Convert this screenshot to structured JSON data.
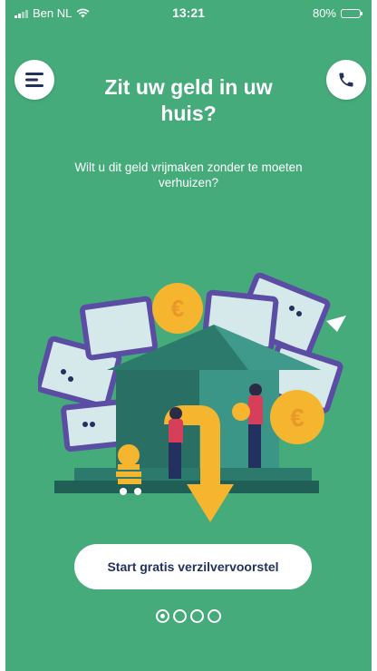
{
  "status_bar": {
    "carrier": "Ben NL",
    "time": "13:21",
    "battery": "80%",
    "battery_level": 0.8
  },
  "header": {
    "menu_icon": "menu-icon",
    "phone_icon": "phone-icon",
    "title": "Zit uw geld in uw huis?",
    "subtitle": "Wilt u dit geld vrijmaken zonder te moeten verhuizen?"
  },
  "illustration": {
    "description_icon": "house-money-illustration"
  },
  "cta": {
    "label": "Start gratis verzilvervoorstel"
  },
  "pagination": {
    "total": 4,
    "active": 1
  },
  "colors": {
    "background": "#45ab7b",
    "button_text": "#23315f",
    "accent_yellow": "#f6b52e"
  }
}
